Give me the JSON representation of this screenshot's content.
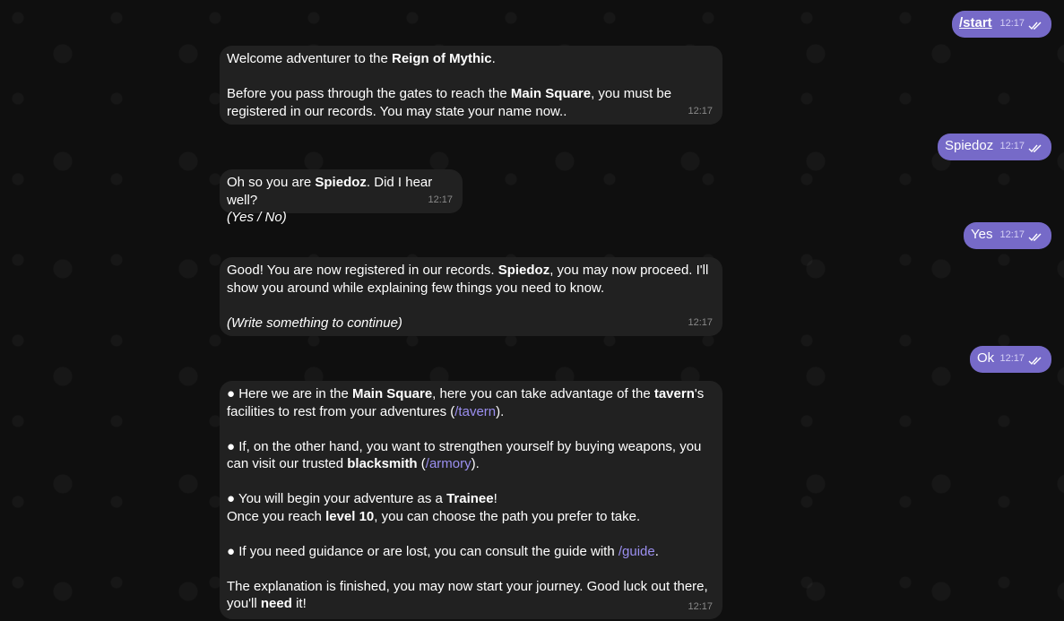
{
  "outgoing": [
    {
      "text": "/start",
      "time": "12:17"
    },
    {
      "text": "Spiedoz",
      "time": "12:17"
    },
    {
      "text": "Yes",
      "time": "12:17"
    },
    {
      "text": "Ok",
      "time": "12:17"
    }
  ],
  "msg1": {
    "l1a": "Welcome adventurer to the ",
    "l1b": "Reign of Mythic",
    "l1c": ".",
    "l2a": "Before you pass through the gates to reach the ",
    "l2b": "Main Square",
    "l2c": ", you must be",
    "l3": "registered in our records. You may state your name now..",
    "time": "12:17"
  },
  "msg2": {
    "l1a": "Oh so you are ",
    "l1b": "Spiedoz",
    "l1c": ". Did I hear well?",
    "l2": "(Yes / No)",
    "time": "12:17"
  },
  "msg3": {
    "l1a": "Good! You are now registered in our records. ",
    "l1b": "Spiedoz",
    "l1c": ", you may now proceed. I'll",
    "l2": "show you around while explaining few things you need to know.",
    "l3": "(Write something to continue)",
    "time": "12:17"
  },
  "msg4": {
    "p1a": "● Here we are in the ",
    "p1b": "Main Square",
    "p1c": ", here you can take advantage of the ",
    "p1d": "tavern",
    "p1e": "'s",
    "p1f": "facilities to rest from your adventures (",
    "p1g": "/tavern",
    "p1h": ").",
    "p2a": "● If, on the other hand, you want to strengthen yourself by buying weapons, you",
    "p2b": "can visit our trusted ",
    "p2c": "blacksmith",
    "p2d": " (",
    "p2e": "/armory",
    "p2f": ").",
    "p3a": "● You will begin your adventure as a ",
    "p3b": "Trainee",
    "p3c": "!",
    "p3d": "Once you reach ",
    "p3e": "level 10",
    "p3f": ", you can choose the path you prefer to take.",
    "p4a": "● If you need guidance or are lost, you can consult the guide with ",
    "p4b": "/guide",
    "p4c": ".",
    "p5a": "The explanation is finished, you may now start your journey. Good luck out there,",
    "p5b": "you'll ",
    "p5c": "need",
    "p5d": " it!",
    "time": "12:17"
  },
  "colors": {
    "outgoing_bubble": "#766ac8",
    "incoming_bubble": "#212121",
    "link": "#9b8ff0"
  }
}
